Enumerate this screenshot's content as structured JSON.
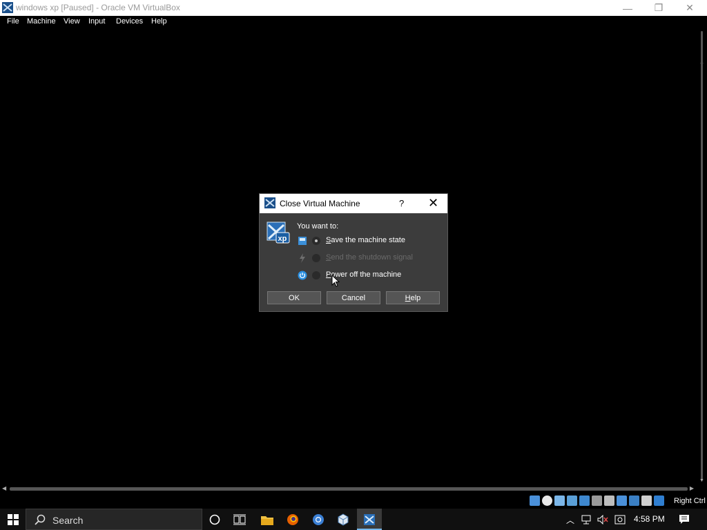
{
  "window": {
    "title": "windows xp [Paused] - Oracle VM VirtualBox",
    "minimize_glyph": "—",
    "restore_glyph": "❐",
    "close_glyph": "✕"
  },
  "menu": [
    "File",
    "Machine",
    "View",
    "Input",
    "Devices",
    "Help"
  ],
  "dialog": {
    "title": "Close Virtual Machine",
    "help_glyph": "?",
    "close_glyph": "✕",
    "prompt": "You want to:",
    "options": [
      {
        "label_underlined": "S",
        "label_rest": "ave the machine state",
        "selected": true,
        "enabled": true,
        "icon": "save-state-icon"
      },
      {
        "label_underlined": "S",
        "label_rest": "end the shutdown signal",
        "selected": false,
        "enabled": false,
        "icon": "shutdown-signal-icon"
      },
      {
        "label_underlined": "P",
        "label_rest": "ower off the machine",
        "selected": false,
        "enabled": true,
        "icon": "power-off-icon"
      }
    ],
    "ok_label": "OK",
    "cancel_label": "Cancel",
    "help_label_underlined": "H",
    "help_label_rest": "elp"
  },
  "statusbar": {
    "host_key": "Right Ctrl",
    "icons": [
      "hard-disk-icon",
      "optical-drive-icon",
      "audio-icon",
      "network-icon",
      "usb-icon",
      "shared-folders-icon",
      "display-icon",
      "video-capture-icon",
      "cpu-icon",
      "mouse-integration-icon",
      "keyboard-icon"
    ]
  },
  "taskbar": {
    "search_placeholder": "Search",
    "clock": "4:58 PM",
    "apps": [
      "cortana-icon",
      "task-view-icon",
      "file-explorer-icon",
      "firefox-icon",
      "chrome-icon",
      "virtualbox-icon",
      "virtualbox-vm-icon"
    ]
  },
  "colors": {
    "accent": "#76b9ed",
    "dialog_bg": "#3c3c3c",
    "taskbar_bg": "#101010"
  }
}
